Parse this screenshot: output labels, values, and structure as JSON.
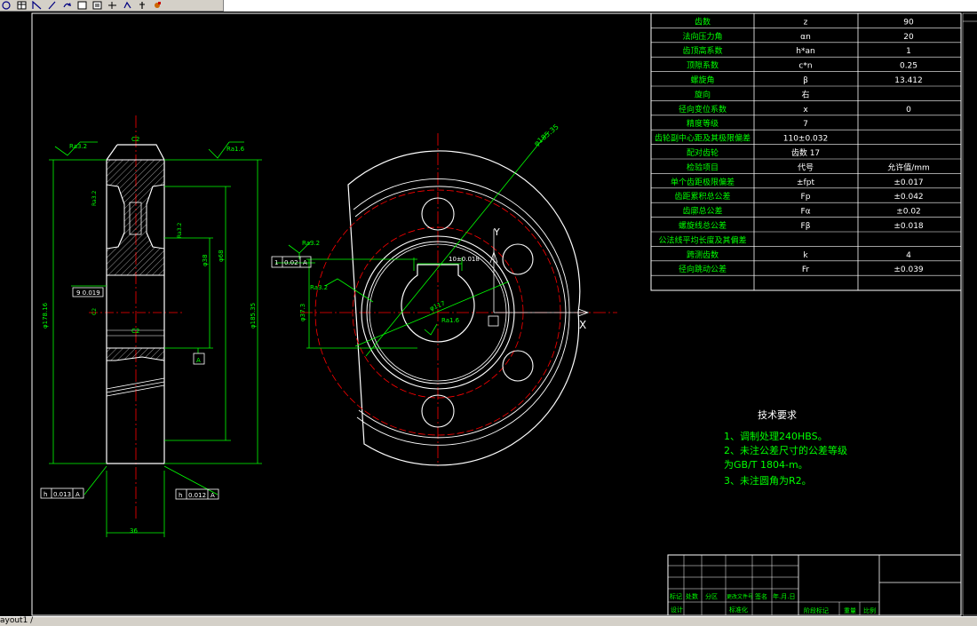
{
  "toolbar": {
    "icons": [
      "circle-tool-icon",
      "table-tool-icon",
      "angular-dim-icon",
      "line-tool-icon",
      "redo-icon",
      "rect-tool-icon",
      "block-tool-icon",
      "move-tool-icon",
      "rotate-tool-icon",
      "insert-icon",
      "image-tool-icon"
    ]
  },
  "colors": {
    "background": "#000000",
    "white": "#ffffff",
    "green": "#00ff00",
    "red": "#ff0000"
  },
  "params_table": {
    "rows": [
      {
        "name": "齿数",
        "symbol": "z",
        "value": "90"
      },
      {
        "name": "法向压力角",
        "symbol": "αn",
        "value": "20"
      },
      {
        "name": "齿顶高系数",
        "symbol": "h*an",
        "value": "1"
      },
      {
        "name": "顶隙系数",
        "symbol": "c*n",
        "value": "0.25"
      },
      {
        "name": "螺旋角",
        "symbol": "β",
        "value": "13.412"
      },
      {
        "name": "旋向",
        "symbol": "右",
        "value": ""
      },
      {
        "name": "径向变位系数",
        "symbol": "x",
        "value": "0"
      },
      {
        "name": "精度等级",
        "symbol": "7",
        "value": ""
      },
      {
        "name": "齿轮副中心距及其极限偏差",
        "symbol": "110±0.032",
        "value": ""
      },
      {
        "name": "配对齿轮",
        "symbol": "齿数 17",
        "value": ""
      },
      {
        "name": "检验项目",
        "symbol": "代号",
        "value": "允许值/mm"
      },
      {
        "name": "单个齿距极限偏差",
        "symbol": "±fpt",
        "value": "±0.017"
      },
      {
        "name": "齿距累积总公差",
        "symbol": "Fp",
        "value": "±0.042"
      },
      {
        "name": "齿廓总公差",
        "symbol": "Fα",
        "value": "±0.02"
      },
      {
        "name": "螺旋线总公差",
        "symbol": "Fβ",
        "value": "±0.018"
      },
      {
        "name": "公法线平均长度及其偏差",
        "symbol": "",
        "value": ""
      },
      {
        "name": "跨测齿数",
        "symbol": "k",
        "value": "4"
      },
      {
        "name": "径向跳动公差",
        "symbol": "Fr",
        "value": "±0.039"
      },
      {
        "name": "",
        "symbol": "",
        "value": ""
      }
    ]
  },
  "tech_requirements": {
    "title": "技术要求",
    "line1": "1、调制处理240HBS。",
    "line2": "2、未注公差尺寸的公差等级",
    "line3": "为GB/T 1804-m。",
    "line4": "3、未注圆角为R2。"
  },
  "side_view": {
    "ra_top": "Ra3.2",
    "ra_top2": "Ra1.6",
    "dim_width": "36",
    "dim_bore": "φ38",
    "dim_hub": "φ68",
    "dim_root": "φ178.16",
    "dim_outer": "φ185.35",
    "tol_a_label": "h",
    "tol_a_value": "0.013",
    "tol_a_datum": "A",
    "tol_b_label": "h",
    "tol_b_value": "0.012",
    "tol_b_datum": "A",
    "datum_a": "A",
    "note_left": "9  0.019",
    "chamfer": "C2",
    "ra_web": "Ra3.2",
    "ra_side": "Ra3.2",
    "label_chamfer_top": "C2",
    "label_chamfer_bottom": "C2"
  },
  "front_view": {
    "tol_label": "1",
    "tol_value": "0.02",
    "tol_datum": "A",
    "ra_left": "Ra3.2",
    "ra_key": "Ra3.2",
    "ra_bore": "Ra1.6",
    "dim_keyway": "10±0.018",
    "dim_bore": "φ37.3",
    "dim_phi": "φ117",
    "dim_diag": "φ185.35",
    "axis_y": "Y",
    "axis_x": "X"
  },
  "title_block": {
    "label_mark": "标记",
    "label_count": "处数",
    "label_zone": "分区",
    "label_change": "更改文件号",
    "label_sign": "签名",
    "label_date": "年.月.日",
    "label_design": "设计",
    "label_standard": "标准化",
    "label_stage": "阶段标记",
    "label_weight": "重量",
    "label_scale": "比例"
  },
  "status_bar": {
    "layout_tab": "ayout1 /"
  }
}
